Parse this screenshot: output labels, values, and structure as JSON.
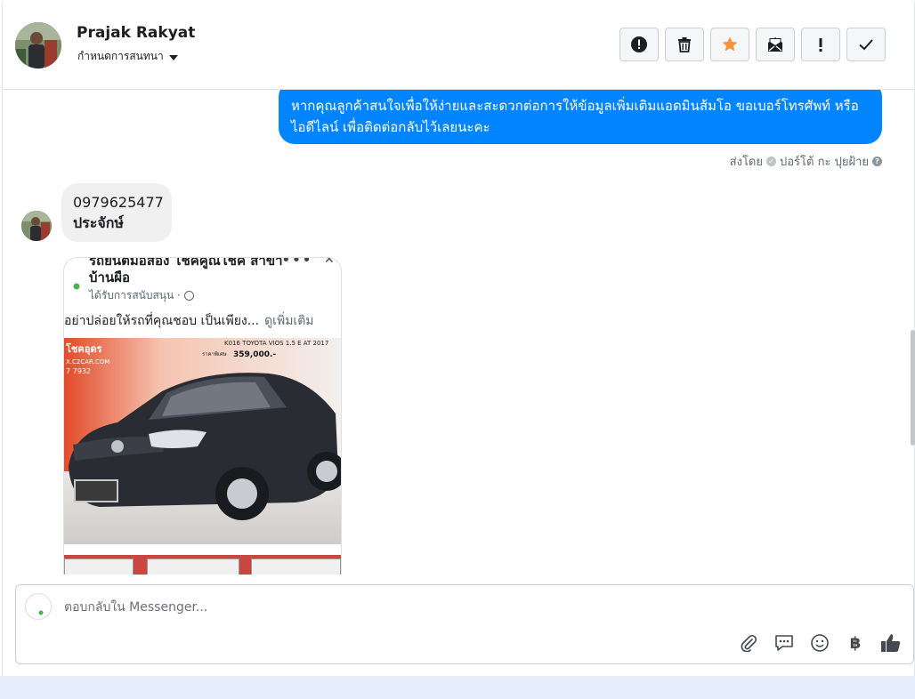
{
  "header": {
    "contact_name": "Prajak Rakyat",
    "assign_label": "กำหนดการสนทนา",
    "toolbar": [
      {
        "name": "report-spam-button",
        "icon": "alert-circle-icon"
      },
      {
        "name": "delete-button",
        "icon": "trash-icon"
      },
      {
        "name": "star-button",
        "icon": "star-icon"
      },
      {
        "name": "mark-unread-button",
        "icon": "envelope-icon"
      },
      {
        "name": "follow-up-button",
        "icon": "exclamation-icon"
      },
      {
        "name": "mark-done-button",
        "icon": "check-icon"
      }
    ]
  },
  "thread": {
    "outgoing_message": "หากคุณลูกค้าสนใจเพื่อให้ง่ายและสะดวกต่อการให้ข้อมูลเพิ่มเติมแอดมินส้มโอ ขอเบอร์โทรศัพท์ หรือ ไอดีไลน์ เพื่อติดต่อกลับไว้เลยนะคะ",
    "sent_by_prefix": "ส่งโดย",
    "sent_by_name": "ปอร์โต้ กะ ปุยฝ้าย",
    "incoming_line1": "0979625477",
    "incoming_line2": "ประจักษ์",
    "shared_card": {
      "title": "รถยนต์มือสอง โชคคูณโชค สาขาบ้านผือ",
      "sponsored": "ได้รับการสนับสนุน ·",
      "text": "อย่าปล่อยให้รถที่คุณชอบ เป็นเพียง...",
      "see_more": "ดูเพิ่มเติม",
      "img_brand": "โชคอุดร",
      "img_site": "X.C2CAR.COM",
      "img_phone": "7 7932",
      "img_model": "K016  TOYOTA VIOS 1.5 E AT 2017",
      "img_price_label": "ราคาพิเศษ",
      "img_price": "359,000.-"
    }
  },
  "composer": {
    "placeholder": "ตอบกลับใน Messenger...",
    "actions": [
      "paperclip-icon",
      "saved-reply-icon",
      "emoji-icon",
      "baht-icon",
      "thumbs-up-icon"
    ]
  },
  "colors": {
    "outgoing_bubble": "#0084ff",
    "incoming_bubble": "#f1f0f0",
    "star": "#f7923a"
  }
}
